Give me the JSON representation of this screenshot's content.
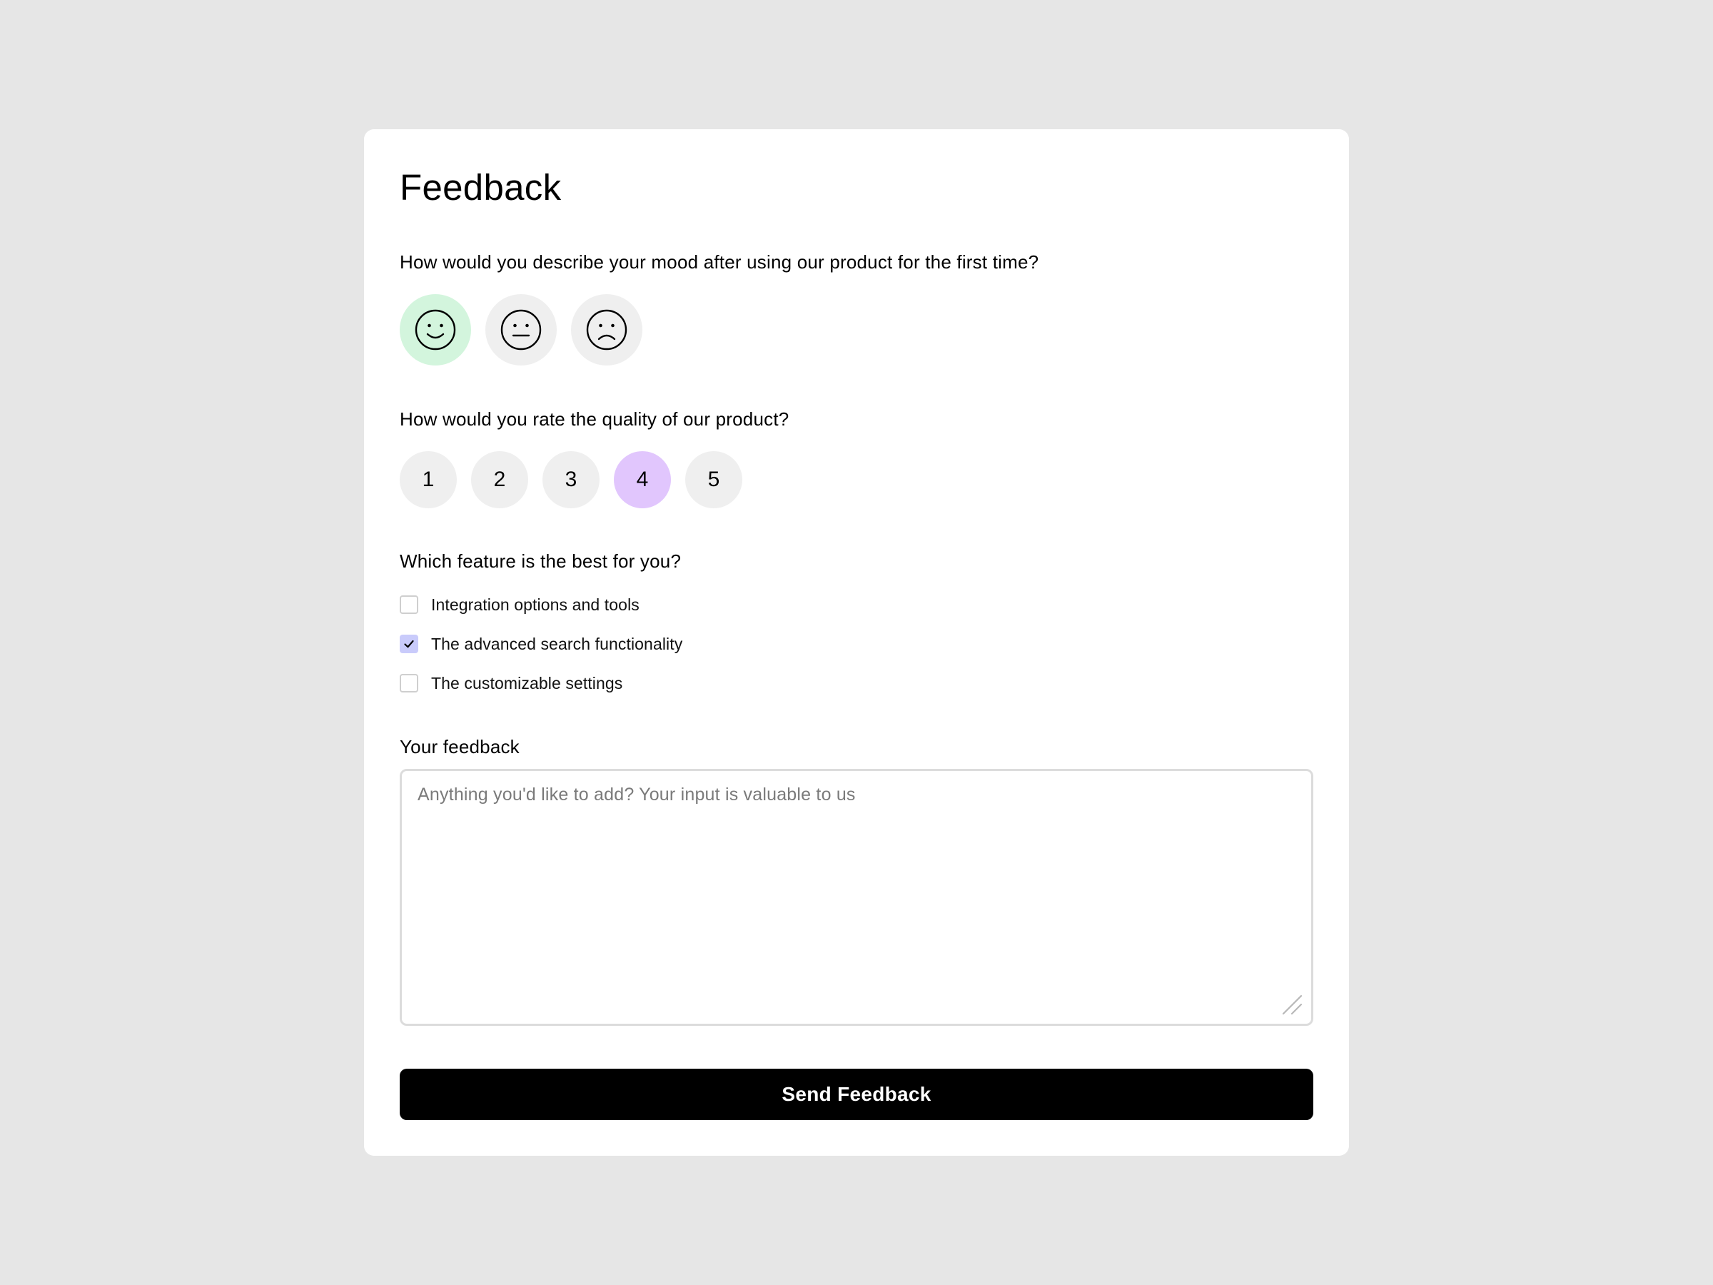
{
  "form": {
    "title": "Feedback",
    "mood": {
      "question": "How would you describe your mood after using our product for the first time?",
      "options": [
        {
          "icon": "happy-face-icon",
          "selected": true,
          "selected_color": "#d3f5dd"
        },
        {
          "icon": "neutral-face-icon",
          "selected": false
        },
        {
          "icon": "sad-face-icon",
          "selected": false
        }
      ]
    },
    "rating": {
      "question": "How would you rate the quality of our product?",
      "options": [
        "1",
        "2",
        "3",
        "4",
        "5"
      ],
      "selected": "4",
      "selected_color": "#e1c6fd"
    },
    "features": {
      "question": "Which feature is the best for you?",
      "options": [
        {
          "label": "Integration options and tools",
          "checked": false
        },
        {
          "label": "The advanced search functionality",
          "checked": true
        },
        {
          "label": "The customizable settings",
          "checked": false
        }
      ],
      "checked_color": "#c9cbfb"
    },
    "feedback": {
      "label": "Your feedback",
      "value": "",
      "placeholder": "Anything you'd like to add? Your input is valuable to us"
    },
    "submit_label": "Send Feedback"
  },
  "colors": {
    "page_background": "#e6e6e6",
    "card_background": "#ffffff",
    "button_background": "#000000",
    "chip_background": "#efefef"
  }
}
